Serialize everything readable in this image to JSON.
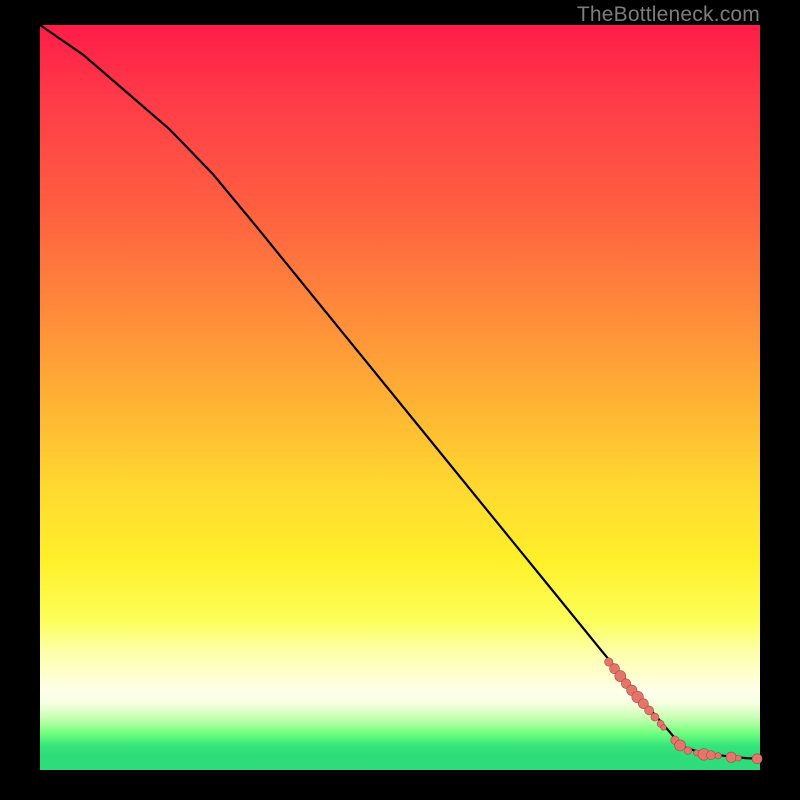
{
  "watermark": "TheBottleneck.com",
  "colors": {
    "gradient_top": "#ff1c47",
    "gradient_mid": "#fff02a",
    "gradient_bottom": "#2fdb7a",
    "marker_fill": "#e5756a",
    "marker_stroke": "#a84d44",
    "curve": "#000000",
    "frame": "#000000"
  },
  "chart_data": {
    "type": "line",
    "title": "",
    "xlabel": "",
    "ylabel": "",
    "xlim": [
      0,
      100
    ],
    "ylim": [
      0,
      100
    ],
    "note": "Axes are unlabeled; values are estimated from pixel positions on a 0–100 normalized scale. Curve descends from top-left, bends near (24,80), then continues nearly linearly to (~89,3) and flattens to the right edge. Markers cluster along the lower-right tail.",
    "series": [
      {
        "name": "curve",
        "x": [
          0,
          6,
          12,
          18,
          24,
          30,
          38,
          46,
          54,
          62,
          70,
          78,
          84,
          88,
          89,
          92,
          95,
          98,
          100
        ],
        "y": [
          100,
          96,
          91,
          86,
          80,
          73,
          63.5,
          54,
          44.5,
          35,
          25.5,
          16,
          9,
          4.5,
          3.2,
          2.3,
          1.9,
          1.6,
          1.5
        ]
      }
    ],
    "markers": [
      {
        "x": 79.0,
        "y": 14.5,
        "r": 4.2
      },
      {
        "x": 79.8,
        "y": 13.6,
        "r": 5.0
      },
      {
        "x": 80.6,
        "y": 12.6,
        "r": 5.5
      },
      {
        "x": 81.4,
        "y": 11.6,
        "r": 4.8
      },
      {
        "x": 82.2,
        "y": 10.7,
        "r": 5.2
      },
      {
        "x": 83.0,
        "y": 9.8,
        "r": 5.8
      },
      {
        "x": 83.8,
        "y": 8.9,
        "r": 5.0
      },
      {
        "x": 84.6,
        "y": 8.0,
        "r": 4.5
      },
      {
        "x": 85.4,
        "y": 7.1,
        "r": 4.0
      },
      {
        "x": 86.2,
        "y": 6.2,
        "r": 3.5
      },
      {
        "x": 86.6,
        "y": 5.7,
        "r": 2.8
      },
      {
        "x": 88.2,
        "y": 4.0,
        "r": 4.2
      },
      {
        "x": 88.9,
        "y": 3.3,
        "r": 5.5
      },
      {
        "x": 90.0,
        "y": 2.6,
        "r": 3.8
      },
      {
        "x": 91.2,
        "y": 2.3,
        "r": 3.0
      },
      {
        "x": 92.2,
        "y": 2.1,
        "r": 5.8
      },
      {
        "x": 93.2,
        "y": 2.0,
        "r": 4.5
      },
      {
        "x": 94.2,
        "y": 1.9,
        "r": 3.2
      },
      {
        "x": 96.0,
        "y": 1.7,
        "r": 5.2
      },
      {
        "x": 97.0,
        "y": 1.6,
        "r": 3.0
      },
      {
        "x": 99.6,
        "y": 1.5,
        "r": 5.0
      }
    ]
  }
}
